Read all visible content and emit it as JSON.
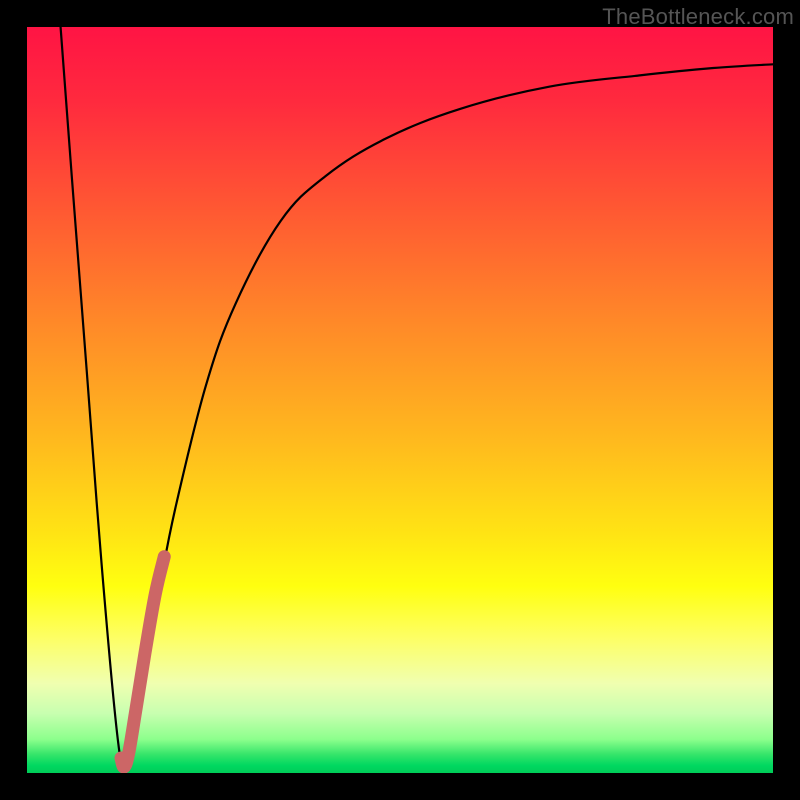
{
  "watermark": "TheBottleneck.com",
  "colors": {
    "frame": "#000000",
    "curve_main": "#000000",
    "curve_highlight": "#cc6666",
    "gradient_top": "#ff1444",
    "gradient_bottom": "#00cc58"
  },
  "chart_data": {
    "type": "line",
    "title": "",
    "xlabel": "",
    "ylabel": "",
    "xlim": [
      0,
      100
    ],
    "ylim": [
      0,
      100
    ],
    "annotations": [
      "TheBottleneck.com"
    ],
    "series": [
      {
        "name": "bottleneck-curve",
        "x": [
          4.5,
          6,
          8,
          10,
          12,
          13,
          14,
          16,
          18,
          20,
          24,
          28,
          34,
          40,
          48,
          58,
          70,
          82,
          92,
          100
        ],
        "y": [
          100,
          80,
          54,
          28,
          6,
          0.8,
          3,
          14,
          26,
          36,
          52,
          63,
          74,
          80,
          85,
          89,
          92,
          93.5,
          94.5,
          95
        ]
      },
      {
        "name": "highlight-segment",
        "x": [
          12.6,
          13.0,
          13.6,
          14.6,
          15.8,
          17.2,
          18.4
        ],
        "y": [
          2.0,
          0.8,
          2.5,
          8.5,
          16.0,
          24.0,
          29.0
        ]
      }
    ],
    "notes": "y is plotted inverted (0 at bottom, 100 at top). Values estimated from pixel positions; no axis labels present in source image."
  }
}
